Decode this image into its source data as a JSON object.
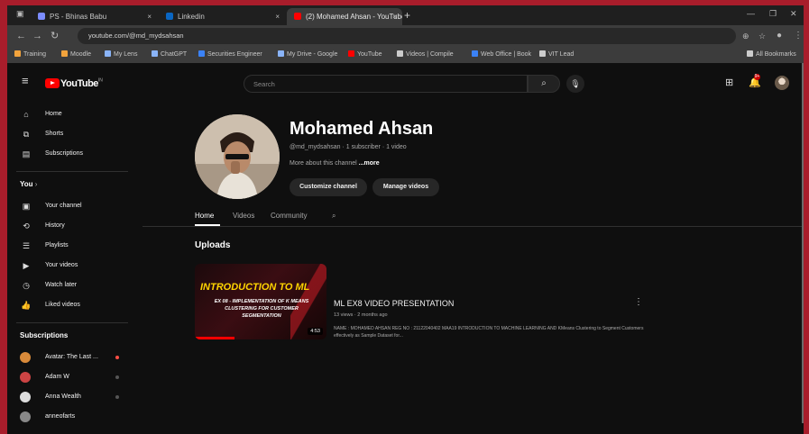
{
  "browser": {
    "tabs": [
      {
        "label": "PS - Bhinas Babu",
        "color": "#7b8cff"
      },
      {
        "label": "Linkedin",
        "color": "#0a66c2"
      },
      {
        "label": "(2) Mohamed Ahsan - YouTube",
        "color": "#ff0000"
      }
    ],
    "url": "youtube.com/@md_mydsahsan",
    "bookmarks": [
      {
        "label": "Training",
        "color": "#f2a33c"
      },
      {
        "label": "Moodle",
        "color": "#f2a33c"
      },
      {
        "label": "My Lens",
        "color": "#8ab4f8"
      },
      {
        "label": "ChatGPT",
        "color": "#8ab4f8"
      },
      {
        "label": "Securities Engineer",
        "color": "#3b82f6"
      },
      {
        "label": "My Drive - Google",
        "color": "#8ab4f8"
      },
      {
        "label": "YouTube",
        "color": "#ff0000"
      },
      {
        "label": "Videos | Compile",
        "color": "#cccccc"
      },
      {
        "label": "Web Office | Book",
        "color": "#3b82f6"
      },
      {
        "label": "VIT Lead",
        "color": "#cccccc"
      }
    ],
    "all_bookmarks": "All Bookmarks"
  },
  "youtube": {
    "logo_text": "YouTube",
    "logo_region": "IN",
    "search_placeholder": "Search",
    "notification_count": "9+",
    "sidebar": {
      "primary": [
        {
          "label": "Home",
          "icon": "home-icon"
        },
        {
          "label": "Shorts",
          "icon": "shorts-icon"
        },
        {
          "label": "Subscriptions",
          "icon": "subscriptions-icon"
        }
      ],
      "you_heading": "You",
      "you_items": [
        {
          "label": "Your channel",
          "icon": "channel-icon"
        },
        {
          "label": "History",
          "icon": "history-icon"
        },
        {
          "label": "Playlists",
          "icon": "playlist-icon"
        },
        {
          "label": "Your videos",
          "icon": "video-icon"
        },
        {
          "label": "Watch later",
          "icon": "clock-icon"
        },
        {
          "label": "Liked videos",
          "icon": "like-icon"
        }
      ],
      "subs_heading": "Subscriptions",
      "subscriptions": [
        {
          "label": "Avatar: The Last ...",
          "color": "#d98a3a",
          "live": true
        },
        {
          "label": "Adam W",
          "color": "#c44",
          "live": false
        },
        {
          "label": "Anna Wealth",
          "color": "#ddd",
          "live": false
        },
        {
          "label": "anneofarts",
          "color": "#888",
          "live": false
        }
      ]
    },
    "channel": {
      "name": "Mohamed Ahsan",
      "meta": "@md_mydsahsan · 1 subscriber · 1 video",
      "about": "More about this channel",
      "about_more": "...more",
      "customize": "Customize channel",
      "manage": "Manage videos",
      "tabs": [
        "Home",
        "Videos",
        "Community"
      ],
      "active_tab": "Home",
      "section": "Uploads",
      "video": {
        "thumb_title": "INTRODUCTION TO ML",
        "thumb_subtitle": "EX 08 - IMPLEMENTATION OF K MEANS CLUSTERING FOR CUSTOMER SEGMENTATION",
        "duration": "4:53",
        "title": "ML EX8 VIDEO PRESENTATION",
        "meta": "13 views · 2 months ago",
        "description": "NAME : MOHAMED AHSAN REG NO : 21122040402 MAA19 INTRODUCTION TO MACHINE LEARNING AND KMeans Clustering to Segment Customers effectively as Sample Dataset for..."
      }
    }
  }
}
